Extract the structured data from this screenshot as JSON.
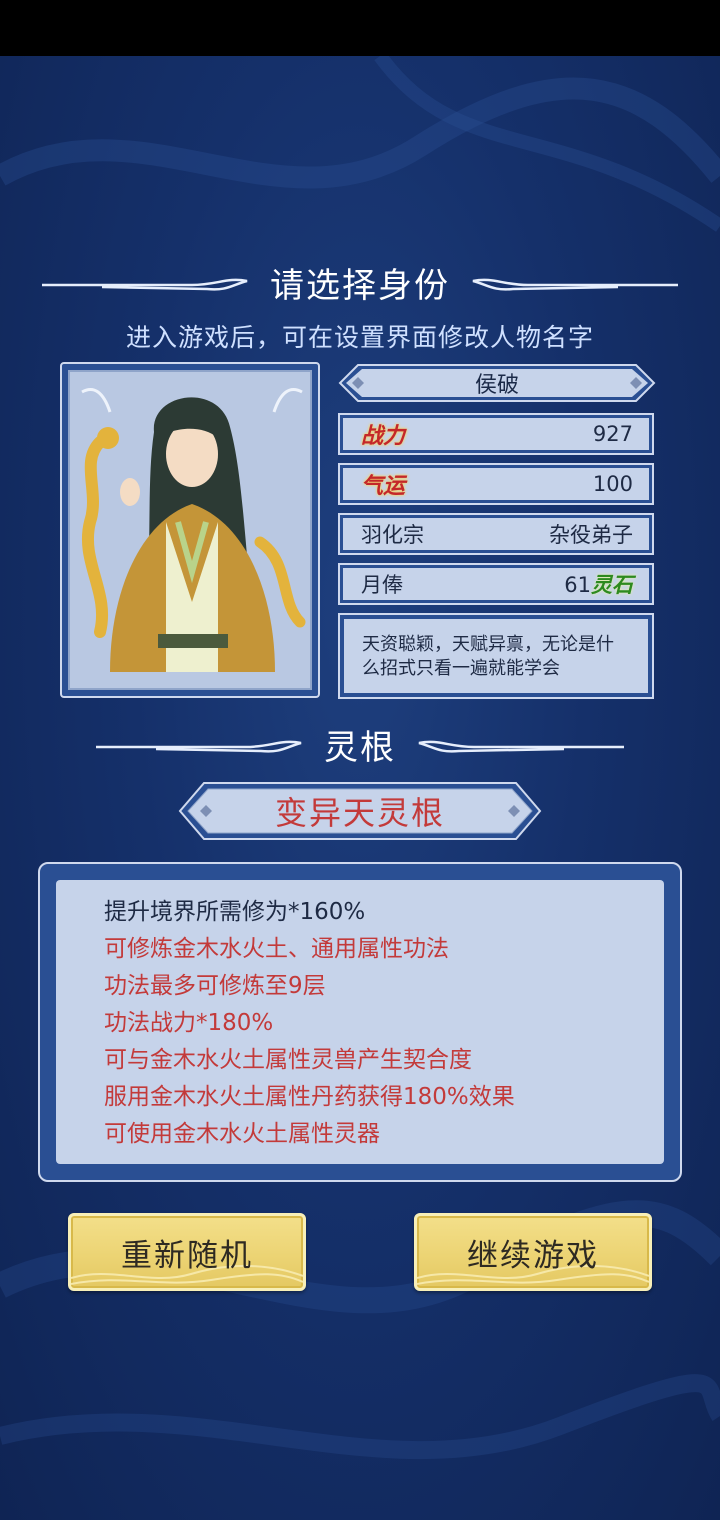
{
  "header": {
    "title": "请选择身份",
    "subtitle": "进入游戏后，可在设置界面修改人物名字"
  },
  "character": {
    "name": "侯破",
    "stats": [
      {
        "label": "战力",
        "value": "927"
      },
      {
        "label": "气运",
        "value": "100"
      }
    ],
    "sect": "羽化宗",
    "rank": "杂役弟子",
    "salary_label": "月俸",
    "salary_value": "61",
    "salary_unit": "灵石",
    "description": "天资聪颖，天赋异禀，无论是什么招式只看一遍就能学会"
  },
  "spirit_root": {
    "section_title": "灵根",
    "type": "变异天灵根",
    "effects": [
      "提升境界所需修为*160%",
      "可修炼金木水火土、通用属性功法",
      "功法最多可修炼至9层",
      "功法战力*180%",
      "可与金木水火土属性灵兽产生契合度",
      "服用金木水火土属性丹药获得180%效果",
      "可使用金木水火土属性灵器"
    ]
  },
  "buttons": {
    "reroll": "重新随机",
    "continue": "继续游戏"
  },
  "colors": {
    "background": "#15306a",
    "panel": "#c6d3ea",
    "accent_red": "#c33a3a",
    "button_gold": "#ecd474"
  }
}
